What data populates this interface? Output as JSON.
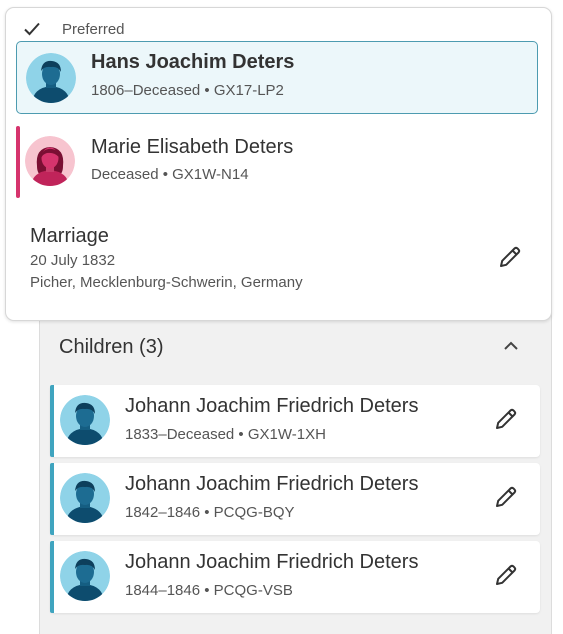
{
  "couple": {
    "preferred_label": "Preferred",
    "husband": {
      "name": "Hans Joachim Deters",
      "meta": "1806–Deceased • GX17-LP2"
    },
    "wife": {
      "name": "Marie Elisabeth Deters",
      "meta": "Deceased • GX1W-N14"
    },
    "marriage": {
      "title": "Marriage",
      "date": "20 July 1832",
      "place": "Picher, Mecklenburg-Schwerin, Germany"
    }
  },
  "children": {
    "header": "Children (3)",
    "items": [
      {
        "name": "Johann Joachim Friedrich Deters",
        "meta": "1833–Deceased • GX1W-1XH"
      },
      {
        "name": "Johann Joachim Friedrich Deters",
        "meta": "1842–1846 • PCQG-BQY"
      },
      {
        "name": "Johann Joachim Friedrich Deters",
        "meta": "1844–1846 • PCQG-VSB"
      }
    ]
  },
  "colors": {
    "male_accent": "#3fa4bf",
    "female_accent": "#d6346d",
    "selected_bg": "#ecf7fa"
  }
}
